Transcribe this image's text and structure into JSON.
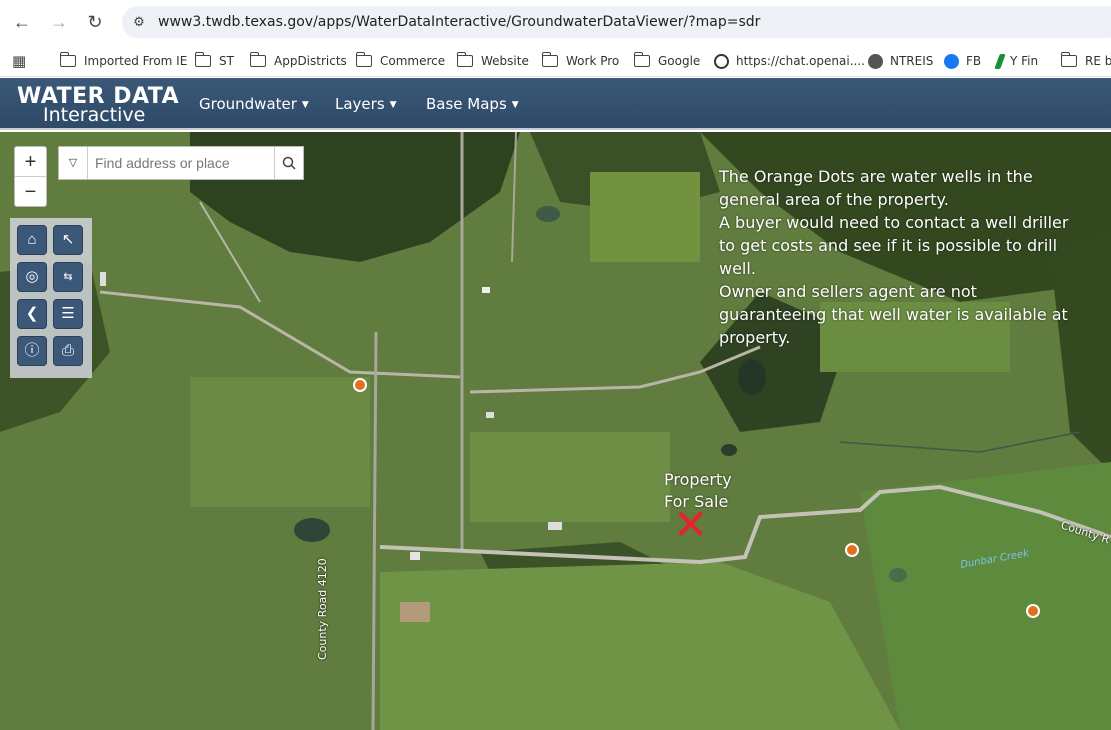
{
  "browser": {
    "url": "www3.twdb.texas.gov/apps/WaterDataInteractive/GroundwaterDataViewer/?map=sdr",
    "bookmarks": [
      {
        "label": "Imported From IE",
        "icon": "folder-icon"
      },
      {
        "label": "ST",
        "icon": "folder-icon"
      },
      {
        "label": "AppDistricts",
        "icon": "folder-icon"
      },
      {
        "label": "Commerce",
        "icon": "folder-icon"
      },
      {
        "label": "Website",
        "icon": "folder-icon"
      },
      {
        "label": "Work Pro",
        "icon": "folder-icon"
      },
      {
        "label": "Google",
        "icon": "folder-icon"
      },
      {
        "label": "https://chat.openai....",
        "icon": "openai-icon"
      },
      {
        "label": "NTREIS",
        "icon": "globe-icon"
      },
      {
        "label": "FB",
        "icon": "facebook-icon"
      },
      {
        "label": "Y Fin",
        "icon": "yahoo-finance-icon"
      },
      {
        "label": "RE bi",
        "icon": "folder-icon"
      }
    ]
  },
  "app": {
    "logo_top": "WATER DATA",
    "logo_bottom": "Interactive",
    "menus": [
      "Groundwater",
      "Layers",
      "Base Maps"
    ]
  },
  "map": {
    "search_placeholder": "Find address or place",
    "zoom_in": "+",
    "zoom_out": "−",
    "note_lines": [
      "The Orange Dots are water wells in the general area of the property.",
      "A buyer would need to contact a well driller to get costs and see if it is possible to drill well.",
      "Owner and sellers agent are not guaranteeing that well water is available at property."
    ],
    "property_label_1": "Property",
    "property_label_2": "For Sale",
    "property_marker": "✕",
    "road_county_4120": "County Road 4120",
    "road_county_r": "County R",
    "creek": "Dunbar Creek",
    "well_color": "#e2701c",
    "marker_color": "#e8222a"
  }
}
